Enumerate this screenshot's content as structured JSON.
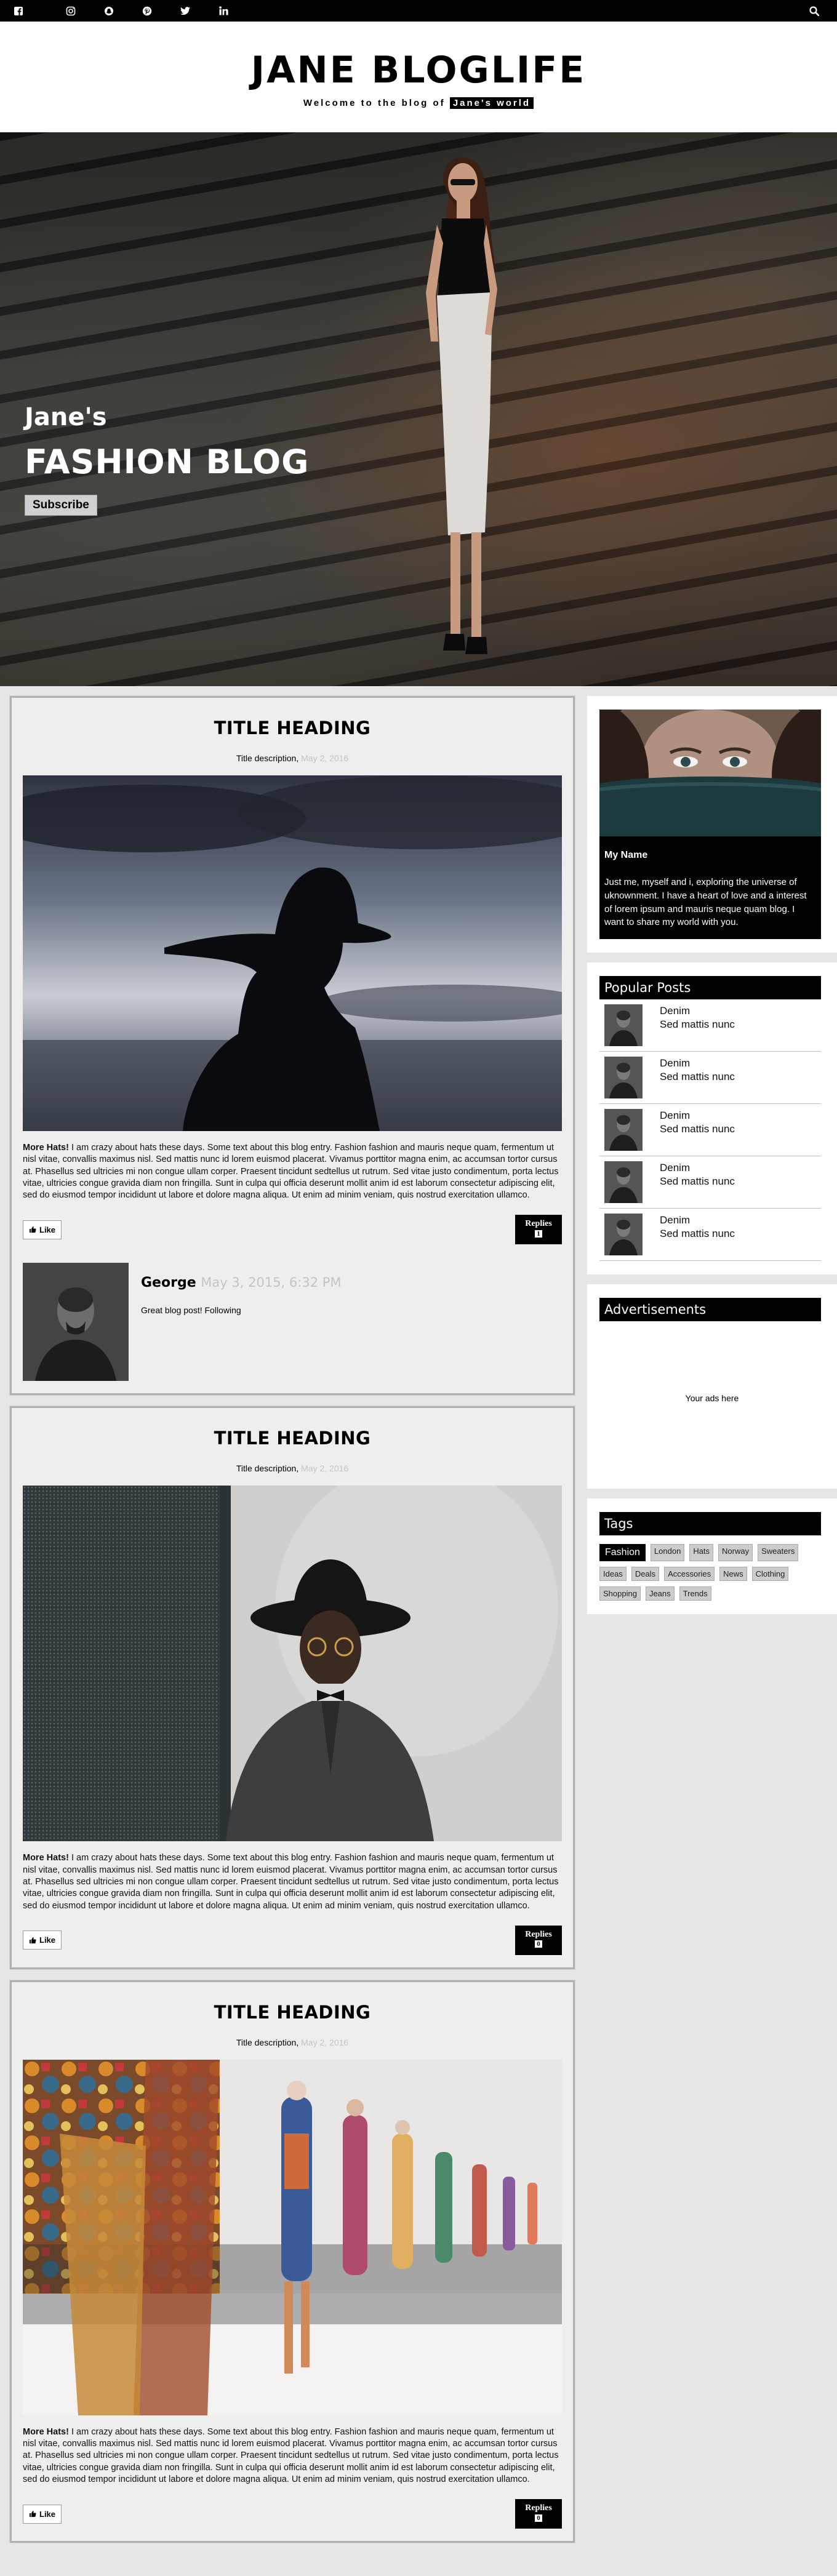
{
  "topbar": {
    "social_icons": [
      "facebook-icon",
      "instagram-icon",
      "snapchat-icon",
      "pinterest-icon",
      "twitter-icon",
      "linkedin-icon"
    ],
    "search_icon": "search-icon"
  },
  "header": {
    "title": "JANE BLOGLIFE",
    "welcome_prefix": "Welcome to the blog of",
    "welcome_highlight": "Jane's world"
  },
  "hero": {
    "line1": "Jane's",
    "line2": "FASHION BLOG",
    "subscribe_label": "Subscribe"
  },
  "posts": [
    {
      "title": "TITLE HEADING",
      "desc": "Title description,",
      "date": "May 2, 2016",
      "lead": "More Hats!",
      "body": " I am crazy about hats these days. Some text about this blog entry. Fashion fashion and mauris neque quam, fermentum ut nisl vitae, convallis maximus nisl. Sed mattis nunc id lorem euismod placerat. Vivamus porttitor magna enim, ac accumsan tortor cursus at. Phasellus sed ultricies mi non congue ullam corper. Praesent tincidunt sedtellus ut rutrum. Sed vitae justo condimentum, porta lectus vitae, ultricies congue gravida diam non fringilla. Sunt in culpa qui officia deserunt mollit anim id est laborum consectetur adipiscing elit, sed do eiusmod tempor incididunt ut labore et dolore magna aliqua. Ut enim ad minim veniam, quis nostrud exercitation ullamco.",
      "like_label": "Like",
      "replies_label": "Replies",
      "replies_count": "1"
    },
    {
      "title": "TITLE HEADING",
      "desc": "Title description,",
      "date": "May 2, 2016",
      "lead": "More Hats!",
      "body": " I am crazy about hats these days. Some text about this blog entry. Fashion fashion and mauris neque quam, fermentum ut nisl vitae, convallis maximus nisl. Sed mattis nunc id lorem euismod placerat. Vivamus porttitor magna enim, ac accumsan tortor cursus at. Phasellus sed ultricies mi non congue ullam corper. Praesent tincidunt sedtellus ut rutrum. Sed vitae justo condimentum, porta lectus vitae, ultricies congue gravida diam non fringilla. Sunt in culpa qui officia deserunt mollit anim id est laborum consectetur adipiscing elit, sed do eiusmod tempor incididunt ut labore et dolore magna aliqua. Ut enim ad minim veniam, quis nostrud exercitation ullamco.",
      "like_label": "Like",
      "replies_label": "Replies",
      "replies_count": "0"
    },
    {
      "title": "TITLE HEADING",
      "desc": "Title description,",
      "date": "May 2, 2016",
      "lead": "More Hats!",
      "body": " I am crazy about hats these days. Some text about this blog entry. Fashion fashion and mauris neque quam, fermentum ut nisl vitae, convallis maximus nisl. Sed mattis nunc id lorem euismod placerat. Vivamus porttitor magna enim, ac accumsan tortor cursus at. Phasellus sed ultricies mi non congue ullam corper. Praesent tincidunt sedtellus ut rutrum. Sed vitae justo condimentum, porta lectus vitae, ultricies congue gravida diam non fringilla. Sunt in culpa qui officia deserunt mollit anim id est laborum consectetur adipiscing elit, sed do eiusmod tempor incididunt ut labore et dolore magna aliqua. Ut enim ad minim veniam, quis nostrud exercitation ullamco.",
      "like_label": "Like",
      "replies_label": "Replies",
      "replies_count": "0"
    }
  ],
  "comment": {
    "name": "George",
    "date": "May 3, 2015, 6:32 PM",
    "text": "Great blog post! Following"
  },
  "sidebar": {
    "about": {
      "name": "My Name",
      "text": "Just me, myself and i, exploring the universe of uknownment. I have a heart of love and a interest of lorem ipsum and mauris neque quam blog. I want to share my world with you."
    },
    "popular": {
      "title": "Popular Posts",
      "items": [
        {
          "title": "Denim",
          "sub": "Sed mattis nunc"
        },
        {
          "title": "Denim",
          "sub": "Sed mattis nunc"
        },
        {
          "title": "Denim",
          "sub": "Sed mattis nunc"
        },
        {
          "title": "Denim",
          "sub": "Sed mattis nunc"
        },
        {
          "title": "Denim",
          "sub": "Sed mattis nunc"
        }
      ]
    },
    "ads": {
      "title": "Advertisements",
      "text": "Your ads here"
    },
    "tags": {
      "title": "Tags",
      "items": [
        "Fashion",
        "London",
        "Hats",
        "Norway",
        "Sweaters",
        "Ideas",
        "Deals",
        "Accessories",
        "News",
        "Clothing",
        "Shopping",
        "Jeans",
        "Trends"
      ]
    }
  },
  "colors": {
    "accent": "#000000",
    "date_gray": "#c4c4c4",
    "tag_bg": "#cccccc"
  }
}
